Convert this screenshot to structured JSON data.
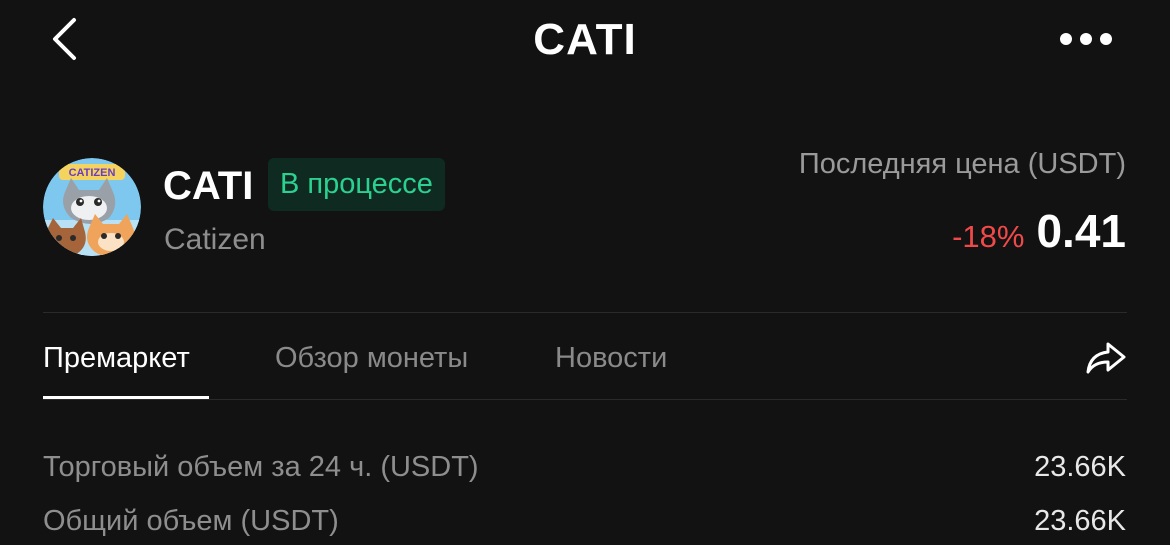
{
  "header": {
    "title": "CATI"
  },
  "coin": {
    "symbol": "CATI",
    "status": "В процессе",
    "name": "Catizen",
    "avatar_text": "CATIZEN"
  },
  "price": {
    "label": "Последняя цена (USDT)",
    "change": "-18%",
    "value": "0.41"
  },
  "tabs": [
    {
      "label": "Премаркет",
      "active": true
    },
    {
      "label": "Обзор монеты",
      "active": false
    },
    {
      "label": "Новости",
      "active": false
    }
  ],
  "stats": [
    {
      "label": "Торговый объем за 24 ч. (USDT)",
      "value": "23.66K"
    },
    {
      "label": "Общий объем (USDT)",
      "value": "23.66K"
    }
  ],
  "colors": {
    "background": "#121212",
    "negative": "#f0494a",
    "status_text": "#2bd190",
    "status_bg": "#0f2a20"
  },
  "icons": [
    "chevron-left-icon",
    "more-horizontal-icon",
    "share-icon"
  ]
}
